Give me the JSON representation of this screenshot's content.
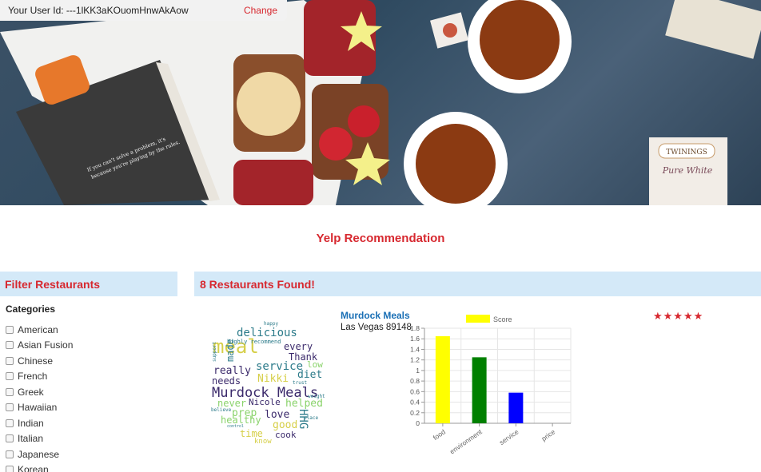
{
  "user_bar": {
    "label": "Your User Id: ---1lKK3aKOuomHnwAkAow",
    "change_label": "Change"
  },
  "app_title": "Yelp Recommendation",
  "filter": {
    "header": "Filter Restaurants",
    "categories_label": "Categories",
    "categories": [
      "American",
      "Asian Fusion",
      "Chinese",
      "French",
      "Greek",
      "Hawaiian",
      "Indian",
      "Italian",
      "Japanese",
      "Korean"
    ]
  },
  "results": {
    "header": "8 Restaurants Found!",
    "restaurant": {
      "name": "Murdock Meals",
      "address": "Las Vegas 89148",
      "stars_text": "★★★★★"
    }
  },
  "wordcloud_words": [
    "Murdock Meals",
    "meal",
    "delicious",
    "service",
    "every",
    "Thank",
    "diet",
    "really",
    "needs",
    "Nikki",
    "helped",
    "never",
    "Nicole",
    "prep",
    "love",
    "healthy",
    "time",
    "good",
    "cook",
    "know",
    "made",
    "low",
    "HHG",
    "happy",
    "highly recommend",
    "support",
    "believe",
    "control",
    "trust",
    "weight",
    "place"
  ],
  "colors": {
    "accent_red": "#d7282f",
    "header_blue": "#d4e9f8",
    "link_blue": "#1a6fb5"
  },
  "chart_data": {
    "type": "bar",
    "categories": [
      "food",
      "environment",
      "service",
      "price"
    ],
    "series": [
      {
        "name": "Score",
        "values": [
          1.65,
          1.25,
          0.58,
          0
        ]
      }
    ],
    "bar_colors": [
      "#ffff00",
      "#008000",
      "#0000ff",
      "#ff0000"
    ],
    "ylim": [
      0,
      1.8
    ],
    "yticks": [
      0,
      0.2,
      0.4,
      0.6,
      0.8,
      1,
      1.2,
      1.4,
      1.6,
      1.8
    ],
    "legend": "top",
    "grid": true
  }
}
